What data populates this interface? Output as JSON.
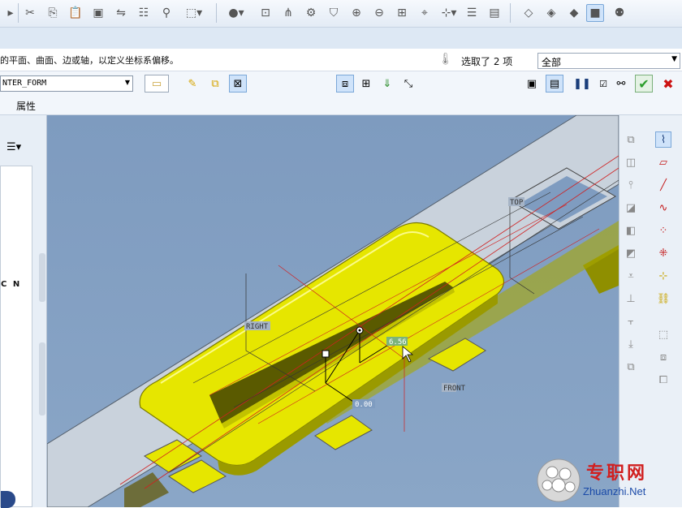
{
  "message": {
    "text": "的平面、曲面、边或轴，以定义坐标系偏移。"
  },
  "selection": {
    "count_text": "选取了 2 项",
    "filter_value": "全部"
  },
  "dashboard": {
    "feature_name": "NTER_FORM"
  },
  "tabs": {
    "properties_label": "属性"
  },
  "left_panel": {
    "partial_text": "C N"
  },
  "model": {
    "labels": {
      "top": "TOP",
      "right": "RIGHT",
      "front": "FRONT"
    },
    "dimensions": {
      "dim_a": "6.56",
      "dim_b": "0.00"
    }
  },
  "watermark": {
    "site_cn": "专职网",
    "site_url": "Zhuanzhi.Net"
  },
  "colors": {
    "viewport_bg": "#7f9cc0",
    "part_gray": "#c9d2dc",
    "feature_yellow": "#e6e600",
    "accept_green": "#2a9d2a",
    "cancel_red": "#cc1111"
  },
  "icons": [
    "cut-icon",
    "copy-icon",
    "paste-icon",
    "paste-special-icon",
    "mirror-icon",
    "regenerate-icon",
    "find-icon",
    "selection-box-icon",
    "appearance-icon",
    "view-manager-icon",
    "network-icon",
    "display-settings-icon",
    "layer-icon",
    "zoom-in-icon",
    "zoom-out-icon",
    "refit-icon",
    "annotation-icon",
    "datum-display-icon",
    "saved-views-icon",
    "wireframe-icon",
    "hidden-line-icon",
    "no-hidden-icon",
    "shading-icon",
    "model-tree-icon"
  ]
}
